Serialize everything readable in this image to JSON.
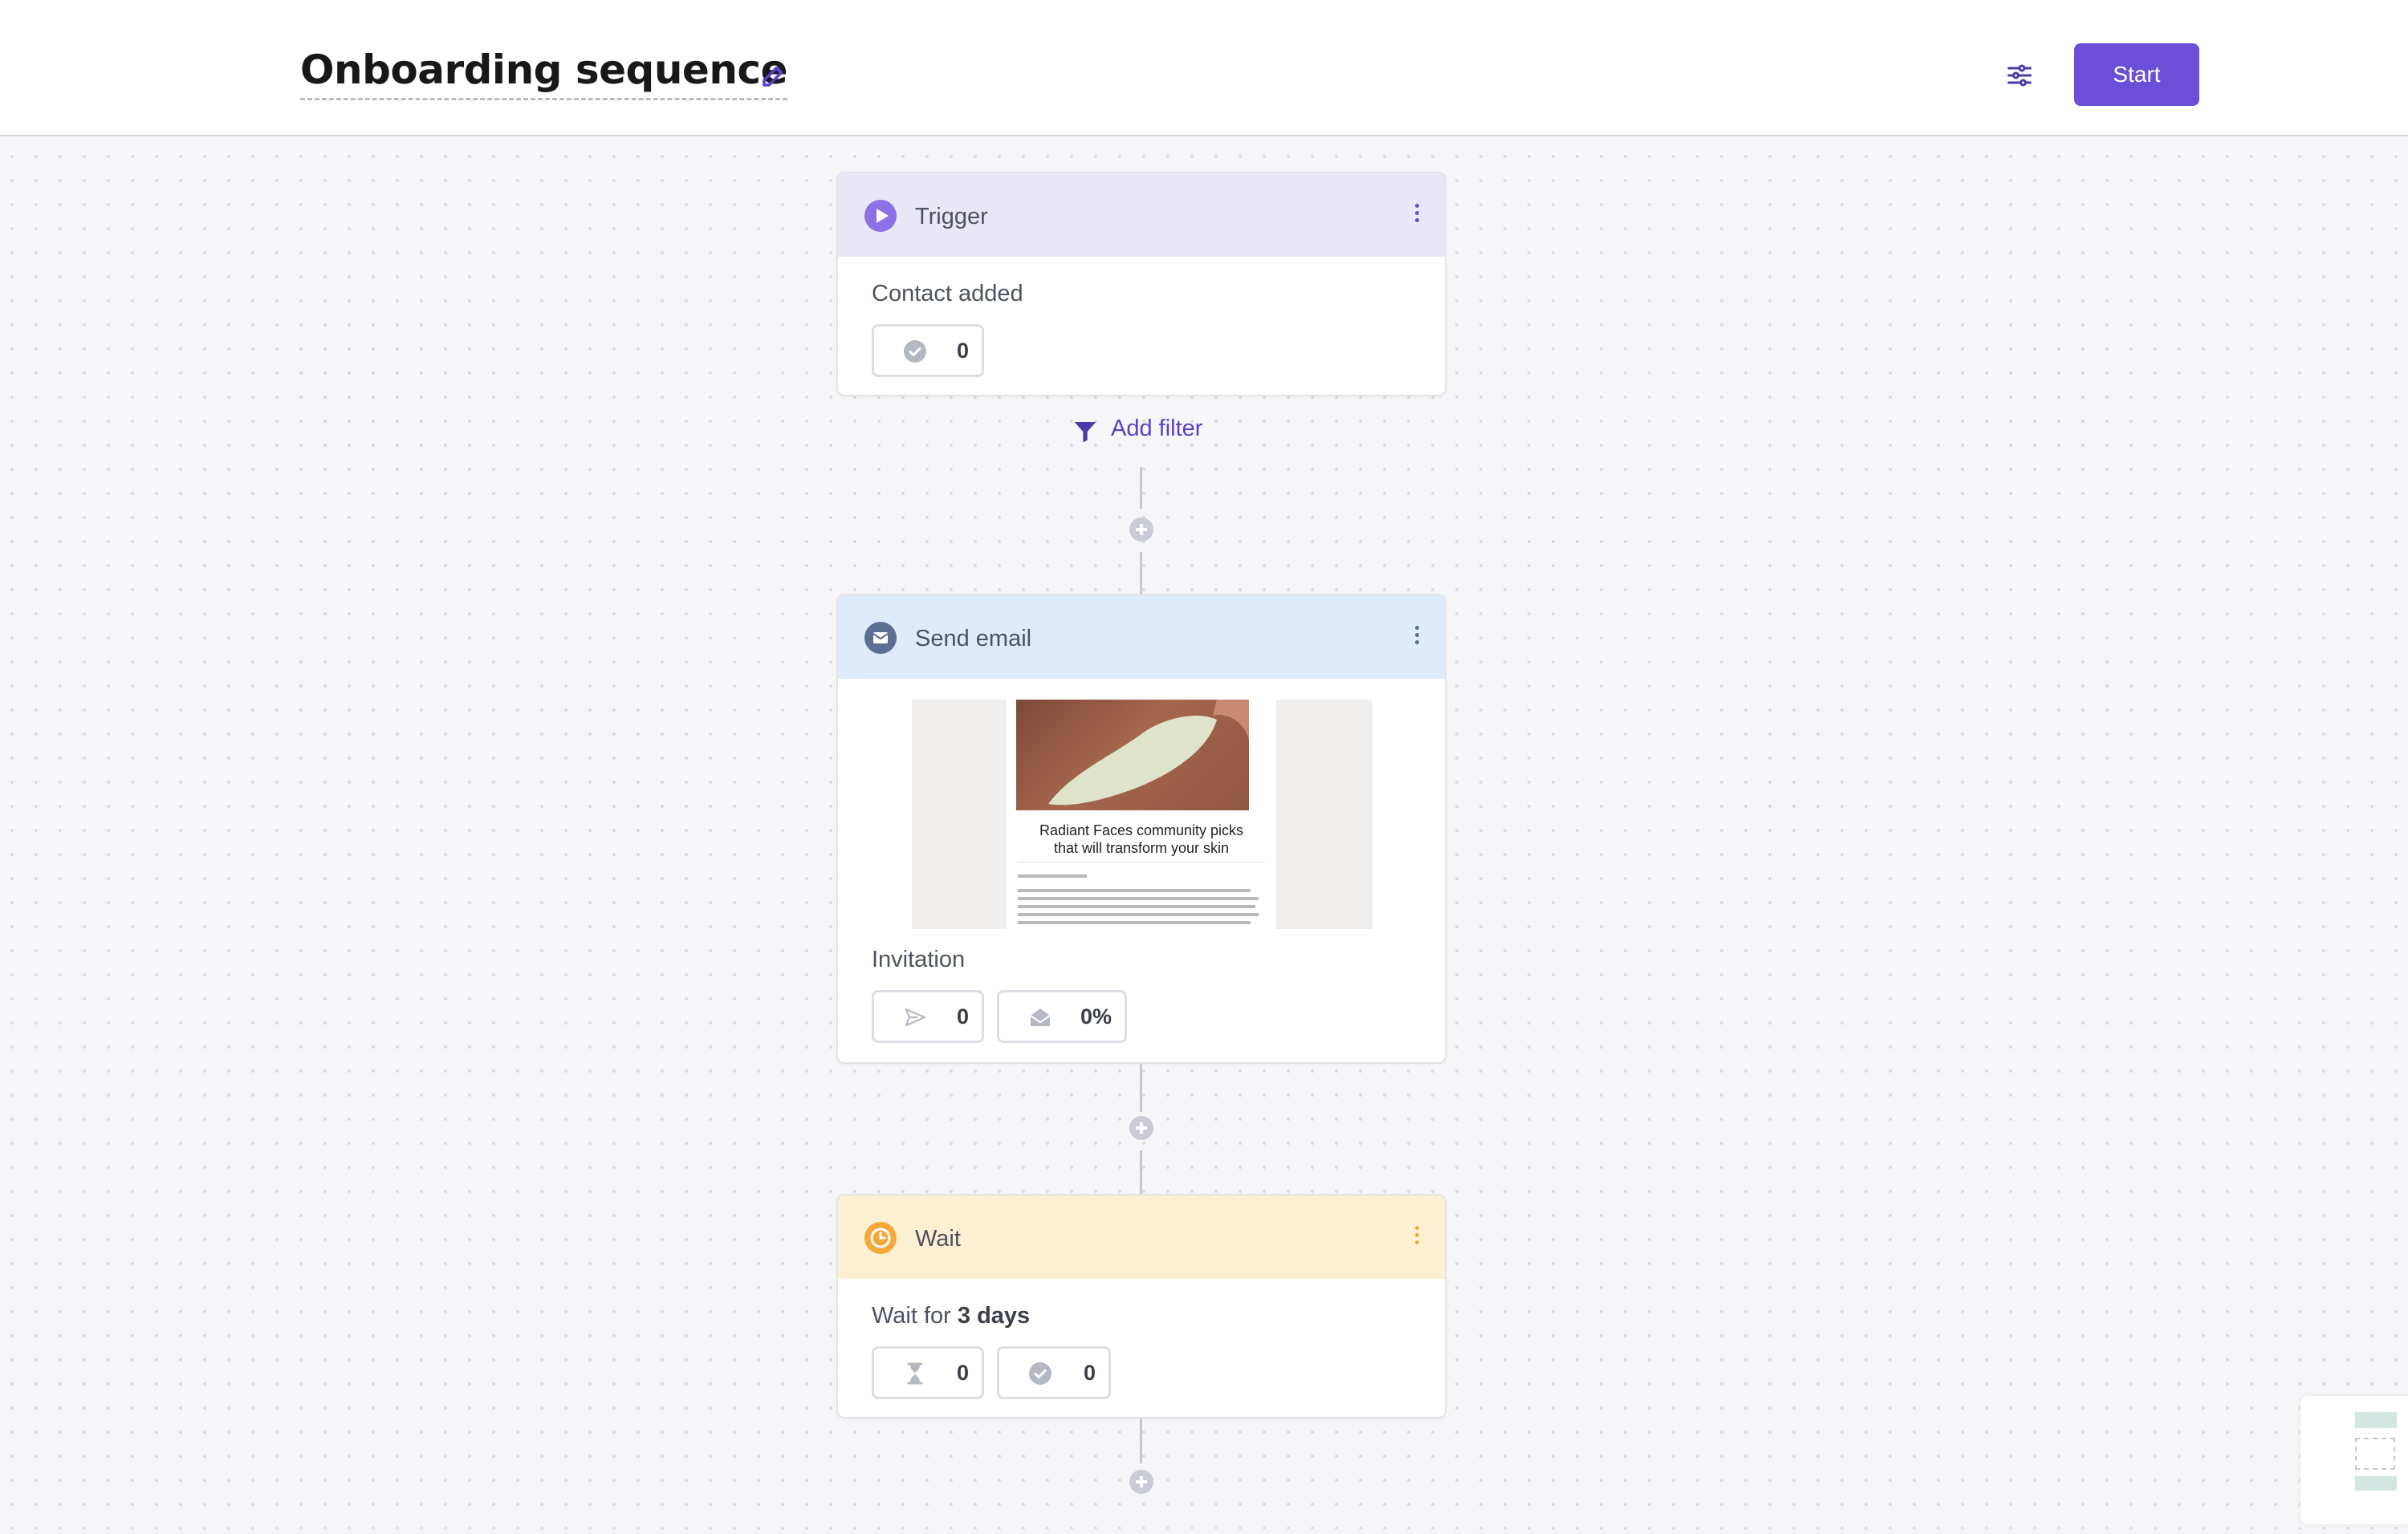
{
  "header": {
    "title": "Onboarding sequence",
    "start_label": "Start"
  },
  "colors": {
    "accent": "#6b4fd8",
    "trigger_head": "#e9e6f5",
    "email_head": "#deebfb",
    "wait_head": "#fdf0d2",
    "wait_icon": "#f3a93a"
  },
  "trigger": {
    "title": "Trigger",
    "event": "Contact added",
    "completed_count": "0"
  },
  "add_filter_label": "Add filter",
  "send_email": {
    "title": "Send email",
    "email_name": "Invitation",
    "sent_count": "0",
    "open_rate": "0%",
    "preview": {
      "headline_line1": "Radiant Faces community picks",
      "headline_line2": "that will transform your skin"
    }
  },
  "wait": {
    "title": "Wait",
    "prefix": "Wait for",
    "duration": "3 days",
    "waiting_count": "0",
    "completed_count": "0"
  }
}
